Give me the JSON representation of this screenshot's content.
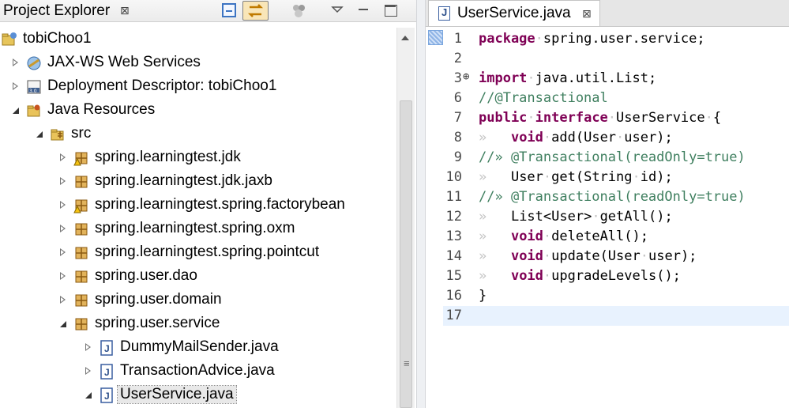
{
  "explorer": {
    "title": "Project Explorer",
    "close_glyph": "⊠",
    "toolbar": [
      "collapse-all-icon",
      "link-with-editor-icon",
      "filter-icon",
      "view-menu-icon",
      "minimize-icon",
      "maximize-icon"
    ],
    "nodes": [
      {
        "label": "tobiChoo1",
        "icon": "project-icon",
        "twisty": "none"
      },
      {
        "label": "JAX-WS Web Services",
        "icon": "web-services-icon",
        "twisty": "collapsed"
      },
      {
        "label": "Deployment Descriptor: tobiChoo1",
        "icon": "deployment-descriptor-icon",
        "twisty": "collapsed"
      },
      {
        "label": "Java Resources",
        "icon": "java-resources-icon",
        "twisty": "expanded"
      },
      {
        "label": "src",
        "icon": "source-folder-icon",
        "twisty": "expanded"
      },
      {
        "label": "spring.learningtest.jdk",
        "icon": "package-warning-icon",
        "twisty": "collapsed"
      },
      {
        "label": "spring.learningtest.jdk.jaxb",
        "icon": "package-icon",
        "twisty": "collapsed"
      },
      {
        "label": "spring.learningtest.spring.factorybean",
        "icon": "package-warning-icon",
        "twisty": "collapsed"
      },
      {
        "label": "spring.learningtest.spring.oxm",
        "icon": "package-icon",
        "twisty": "collapsed"
      },
      {
        "label": "spring.learningtest.spring.pointcut",
        "icon": "package-icon",
        "twisty": "collapsed"
      },
      {
        "label": "spring.user.dao",
        "icon": "package-icon",
        "twisty": "collapsed"
      },
      {
        "label": "spring.user.domain",
        "icon": "package-icon",
        "twisty": "collapsed"
      },
      {
        "label": "spring.user.service",
        "icon": "package-icon",
        "twisty": "expanded"
      },
      {
        "label": "DummyMailSender.java",
        "icon": "java-file-icon",
        "twisty": "collapsed"
      },
      {
        "label": "TransactionAdvice.java",
        "icon": "java-file-icon",
        "twisty": "collapsed"
      },
      {
        "label": "UserService.java",
        "icon": "java-file-icon",
        "twisty": "expanded",
        "selected": true
      }
    ]
  },
  "editor": {
    "tab_label": "UserService.java",
    "tab_close_glyph": "⊠",
    "fold_glyph": "⊕",
    "whitespace_glyph": "»",
    "lines": [
      {
        "n": "1",
        "tokens": [
          {
            "t": "package",
            "c": "kw"
          },
          {
            "t": "·",
            "c": "ws"
          },
          {
            "t": "spring.user.service;"
          }
        ]
      },
      {
        "n": "2",
        "tokens": []
      },
      {
        "n": "3",
        "fold": true,
        "tokens": [
          {
            "t": "import",
            "c": "kw"
          },
          {
            "t": "·",
            "c": "ws"
          },
          {
            "t": "java.util.List;"
          }
        ]
      },
      {
        "n": "6",
        "tokens": [
          {
            "t": "//@Transactional",
            "c": "cm"
          }
        ]
      },
      {
        "n": "7",
        "tokens": [
          {
            "t": "public",
            "c": "kw"
          },
          {
            "t": "·",
            "c": "ws"
          },
          {
            "t": "interface",
            "c": "kw"
          },
          {
            "t": "·",
            "c": "ws"
          },
          {
            "t": "UserService"
          },
          {
            "t": "·",
            "c": "ws"
          },
          {
            "t": "{"
          }
        ]
      },
      {
        "n": "8",
        "tokens": [
          {
            "t": "»   ",
            "c": "ws"
          },
          {
            "t": "void",
            "c": "kw"
          },
          {
            "t": "·",
            "c": "ws"
          },
          {
            "t": "add(User"
          },
          {
            "t": "·",
            "c": "ws"
          },
          {
            "t": "user);"
          }
        ]
      },
      {
        "n": "9",
        "tokens": [
          {
            "t": "//» @Transactional(readOnly=true)",
            "c": "cm"
          }
        ]
      },
      {
        "n": "10",
        "tokens": [
          {
            "t": "»   ",
            "c": "ws"
          },
          {
            "t": "User"
          },
          {
            "t": "·",
            "c": "ws"
          },
          {
            "t": "get(String"
          },
          {
            "t": "·",
            "c": "ws"
          },
          {
            "t": "id);"
          }
        ]
      },
      {
        "n": "11",
        "tokens": [
          {
            "t": "//» @Transactional(readOnly=true)",
            "c": "cm"
          }
        ]
      },
      {
        "n": "12",
        "tokens": [
          {
            "t": "»   ",
            "c": "ws"
          },
          {
            "t": "List<User>"
          },
          {
            "t": "·",
            "c": "ws"
          },
          {
            "t": "getAll();"
          }
        ]
      },
      {
        "n": "13",
        "tokens": [
          {
            "t": "»   ",
            "c": "ws"
          },
          {
            "t": "void",
            "c": "kw"
          },
          {
            "t": "·",
            "c": "ws"
          },
          {
            "t": "deleteAll();"
          }
        ]
      },
      {
        "n": "14",
        "tokens": [
          {
            "t": "»   ",
            "c": "ws"
          },
          {
            "t": "void",
            "c": "kw"
          },
          {
            "t": "·",
            "c": "ws"
          },
          {
            "t": "update(User"
          },
          {
            "t": "·",
            "c": "ws"
          },
          {
            "t": "user);"
          }
        ]
      },
      {
        "n": "15",
        "tokens": [
          {
            "t": "»   ",
            "c": "ws"
          },
          {
            "t": "void",
            "c": "kw"
          },
          {
            "t": "·",
            "c": "ws"
          },
          {
            "t": "upgradeLevels();"
          }
        ]
      },
      {
        "n": "16",
        "tokens": [
          {
            "t": "}"
          }
        ]
      },
      {
        "n": "17",
        "tokens": [],
        "current": true
      }
    ]
  },
  "colors": {
    "keyword": "#7f0055",
    "comment": "#3f7f5f",
    "current_line": "#e8f2fe",
    "selection": "#e8e8e8"
  }
}
